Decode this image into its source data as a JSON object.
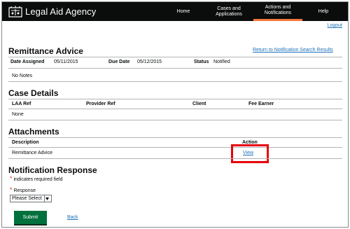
{
  "header": {
    "brand": "Legal Aid Agency",
    "nav": [
      {
        "label": "Home"
      },
      {
        "label": "Cases and Applications"
      },
      {
        "label": "Actions and Notifications"
      },
      {
        "label": "Help"
      }
    ],
    "logout": "Logout",
    "colors": {
      "bar": "#0b0c0c",
      "active_underline": "#f47738"
    }
  },
  "remittance": {
    "title": "Remittance Advice",
    "return_link": "Return to Notification Search Results",
    "date_assigned_label": "Date Assigned",
    "date_assigned": "05/11/2015",
    "due_date_label": "Due Date",
    "due_date": "05/12/2015",
    "status_label": "Status",
    "status": "Notified",
    "notes": "No Notes"
  },
  "case_details": {
    "title": "Case Details",
    "columns": [
      "LAA Ref",
      "Provider Ref",
      "Client",
      "Fee Earner"
    ],
    "empty": "None"
  },
  "attachments": {
    "title": "Attachments",
    "columns": [
      "Description",
      "Action"
    ],
    "rows": [
      {
        "description": "Remittance Advice",
        "action": "View"
      }
    ]
  },
  "notification_response": {
    "title": "Notification Response",
    "required_note": "indicates required field",
    "response_label": "Response",
    "response_value": "Please Select"
  },
  "buttons": {
    "submit": "Submit",
    "back": "Back"
  },
  "colors": {
    "link": "#1d70b8",
    "submit": "#00703c",
    "highlight": "#e8000b",
    "required": "#d4351c"
  }
}
